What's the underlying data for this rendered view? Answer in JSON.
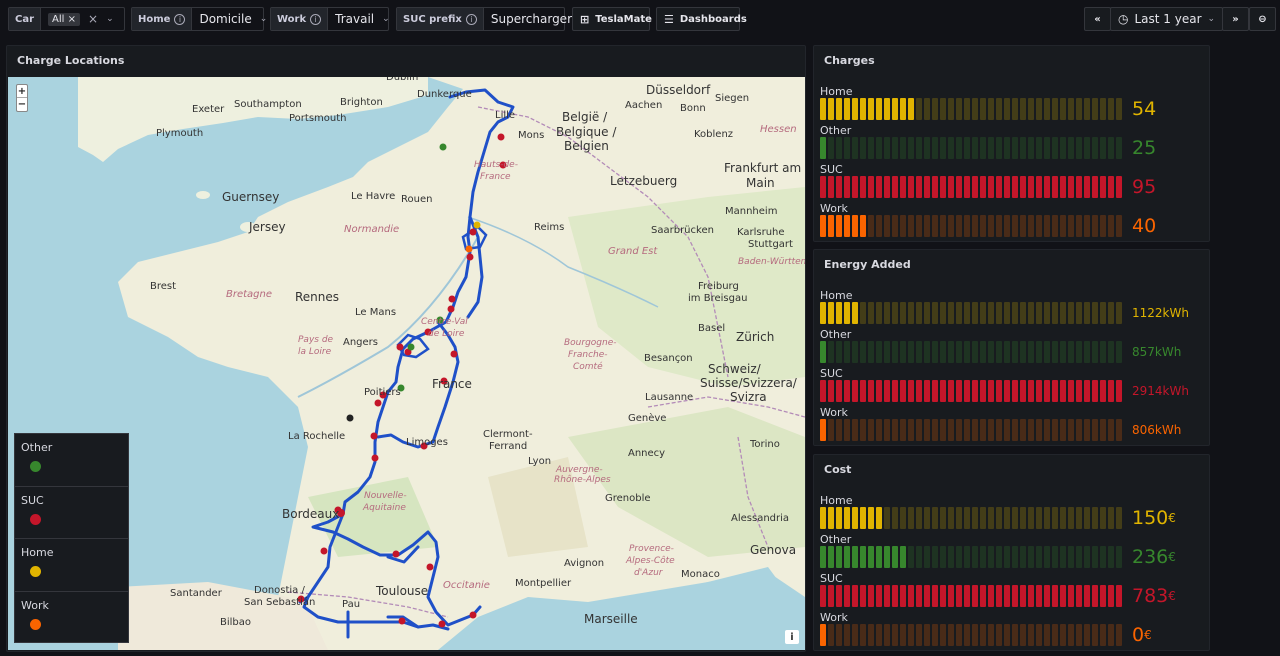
{
  "toolbar": {
    "car": {
      "label": "Car",
      "chip": "All"
    },
    "home": {
      "label": "Home",
      "value": "Domicile"
    },
    "work": {
      "label": "Work",
      "value": "Travail"
    },
    "suc": {
      "label": "SUC prefix",
      "value": "Supercharger"
    },
    "teslamate": "TeslaMate",
    "dashboards": "Dashboards",
    "time_range": "Last 1 year"
  },
  "map_panel": {
    "title": "Charge Locations",
    "zoom_in": "+",
    "zoom_out": "−",
    "attribution": "i",
    "legend": [
      {
        "name": "Other",
        "color": "#37872d"
      },
      {
        "name": "SUC",
        "color": "#c4162a"
      },
      {
        "name": "Home",
        "color": "#e0b400"
      },
      {
        "name": "Work",
        "color": "#fa6400"
      }
    ],
    "place_labels": [
      "Exeter",
      "Southampton",
      "Brighton",
      "Plymouth",
      "Portsmouth",
      "Dunkerque",
      "Lille",
      "Mons",
      "België / Belgique / Belgien",
      "Düsseldorf",
      "Aachen",
      "Bonn",
      "Siegen",
      "Koblenz",
      "Hessen",
      "Frankfurt am Main",
      "Letzebuerg",
      "Mannheim",
      "Saarbrücken",
      "Karlsruhe",
      "Baden-Württemberg",
      "Stuttgart",
      "Le Havre",
      "Rouen",
      "Reims",
      "Guernsey",
      "Jersey",
      "Normandie",
      "Hauts-de-France",
      "Grand Est",
      "Brest",
      "Bretagne",
      "Rennes",
      "Le Mans",
      "Angers",
      "Pays de la Loire",
      "Centre-Val de Loire",
      "Poitiers",
      "Freiburg im Breisgau",
      "Basel",
      "Zürich",
      "Besançon",
      "Bourgogne-Franche-Comté",
      "France",
      "Lausanne",
      "Schweiz/ Suisse/Svizzera/ Svizra",
      "Genève",
      "La Rochelle",
      "Limoges",
      "Clermont-Ferrand",
      "Annecy",
      "Lyon",
      "Auvergne-Rhône-Alpes",
      "Grenoble",
      "Torino",
      "Alessandria",
      "Bordeaux",
      "Nouvelle-Aquitaine",
      "Genova",
      "Provence-Alpes-Côte d'Azur",
      "Avignon",
      "Monaco",
      "Montpellier",
      "Occitanie",
      "Toulouse",
      "Santander",
      "Donostia / San Sebastián",
      "Bilbao",
      "Pau",
      "Marseille",
      "Dublin"
    ]
  },
  "charges": {
    "title": "Charges",
    "rows": [
      {
        "name": "Home",
        "value": "54",
        "unit": "",
        "fraction": 0.31,
        "color": "#e0b400"
      },
      {
        "name": "Other",
        "value": "25",
        "unit": "",
        "fraction": 0.03,
        "color": "#37872d"
      },
      {
        "name": "SUC",
        "value": "95",
        "unit": "",
        "fraction": 1.0,
        "color": "#c4162a"
      },
      {
        "name": "Work",
        "value": "40",
        "unit": "",
        "fraction": 0.17,
        "color": "#fa6400"
      }
    ]
  },
  "energy": {
    "title": "Energy Added",
    "rows": [
      {
        "name": "Home",
        "value": "1122",
        "unit": " kWh",
        "fraction": 0.13,
        "color": "#e0b400"
      },
      {
        "name": "Other",
        "value": "857",
        "unit": " kWh",
        "fraction": 0.03,
        "color": "#37872d"
      },
      {
        "name": "SUC",
        "value": "2914",
        "unit": " kWh",
        "fraction": 1.0,
        "color": "#c4162a"
      },
      {
        "name": "Work",
        "value": "806",
        "unit": " kWh",
        "fraction": 0.03,
        "color": "#fa6400"
      }
    ]
  },
  "cost": {
    "title": "Cost",
    "rows": [
      {
        "name": "Home",
        "value": "150",
        "unit": " €",
        "fraction": 0.2,
        "color": "#e0b400"
      },
      {
        "name": "Other",
        "value": "236",
        "unit": " €",
        "fraction": 0.3,
        "color": "#37872d"
      },
      {
        "name": "SUC",
        "value": "783",
        "unit": " €",
        "fraction": 1.0,
        "color": "#c4162a"
      },
      {
        "name": "Work",
        "value": "0",
        "unit": " €",
        "fraction": 0.03,
        "color": "#fa6400"
      }
    ]
  }
}
